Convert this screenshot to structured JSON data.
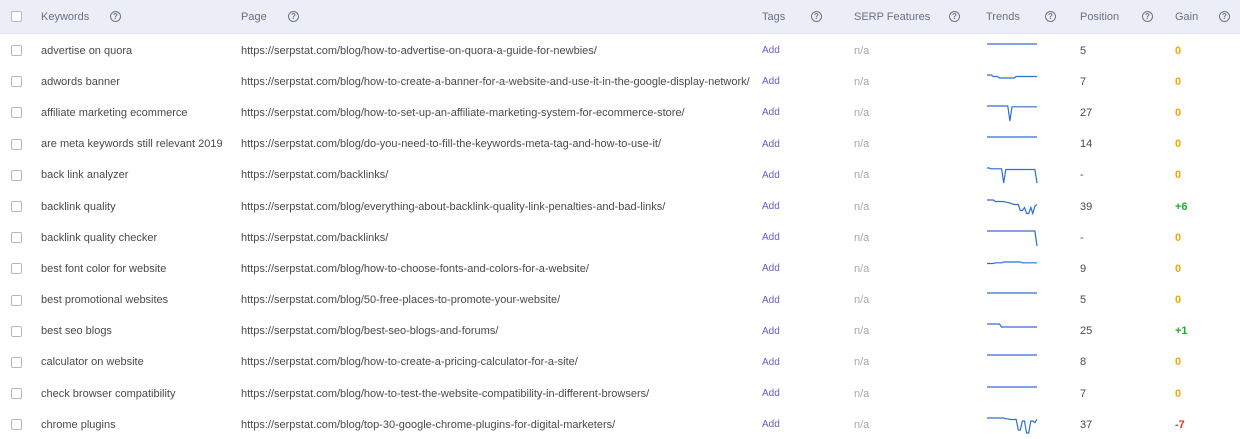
{
  "header": {
    "keywords": "Keywords",
    "page": "Page",
    "tags": "Tags",
    "serp": "SERP Features",
    "trends": "Trends",
    "position": "Position",
    "gain": "Gain",
    "help_glyph": "?"
  },
  "colors": {
    "header_bg": "#eceef7",
    "add_link": "#6a5acd",
    "gain_zero": "#f5a700",
    "gain_up": "#1fae2f",
    "gain_down": "#e4332a",
    "trend_line": "#2d6fd1"
  },
  "rows": [
    {
      "keyword": "advertise on quora",
      "url": "https://serpstat.com/blog/how-to-advertise-on-quora-a-guide-for-newbies/",
      "tags": "Add",
      "serp": "n/a",
      "position": "5",
      "gain": "0",
      "trend": [
        0,
        0,
        0,
        0,
        0,
        0,
        0,
        0,
        0,
        0,
        0,
        0,
        0,
        0,
        0,
        0,
        0,
        0,
        0,
        0,
        0,
        0,
        0,
        0,
        0
      ]
    },
    {
      "keyword": "adwords banner",
      "url": "https://serpstat.com/blog/how-to-create-a-banner-for-a-website-and-use-it-in-the-google-display-network/",
      "tags": "Add",
      "serp": "n/a",
      "position": "7",
      "gain": "0",
      "trend": [
        0,
        0,
        0,
        0.1,
        0.1,
        0.1,
        0.2,
        0.2,
        0.2,
        0.2,
        0.2,
        0.2,
        0.2,
        0.2,
        0.1,
        0.1,
        0.1,
        0.1,
        0.1,
        0.1,
        0.1,
        0.1,
        0.1,
        0.1,
        0.1
      ]
    },
    {
      "keyword": "affiliate marketing ecommerce",
      "url": "https://serpstat.com/blog/how-to-set-up-an-affiliate-marketing-system-for-ecommerce-store/",
      "tags": "Add",
      "serp": "n/a",
      "position": "27",
      "gain": "0",
      "trend": [
        0,
        0,
        0,
        0,
        0,
        0,
        0,
        0,
        0,
        0,
        0,
        1,
        0.05,
        0.05,
        0.05,
        0.05,
        0.05,
        0.05,
        0.05,
        0.05,
        0.05,
        0.05,
        0.05,
        0.05,
        0.05
      ]
    },
    {
      "keyword": "are meta keywords still relevant 2019",
      "url": "https://serpstat.com/blog/do-you-need-to-fill-the-keywords-meta-tag-and-how-to-use-it/",
      "tags": "Add",
      "serp": "n/a",
      "position": "14",
      "gain": "0",
      "trend": [
        0,
        0,
        0,
        0,
        0,
        0,
        0,
        0,
        0,
        0,
        0,
        0,
        0,
        0,
        0,
        0,
        0,
        0,
        0,
        0,
        0,
        0,
        0,
        0,
        0
      ]
    },
    {
      "keyword": "back link analyzer",
      "url": "https://serpstat.com/backlinks/",
      "tags": "Add",
      "serp": "n/a",
      "position": "-",
      "gain": "0",
      "trend": [
        0,
        0,
        0.05,
        0.05,
        0.05,
        0.05,
        0.05,
        0.05,
        1,
        0.1,
        0.1,
        0.1,
        0.1,
        0.1,
        0.1,
        0.1,
        0.1,
        0.1,
        0.1,
        0.1,
        0.1,
        0.1,
        0.1,
        0.1,
        1
      ]
    },
    {
      "keyword": "backlink quality",
      "url": "https://serpstat.com/blog/everything-about-backlink-quality-link-penalties-and-bad-links/",
      "tags": "Add",
      "serp": "n/a",
      "position": "39",
      "gain": "+6",
      "trend": [
        0,
        0,
        0,
        0,
        0.1,
        0.1,
        0.1,
        0.1,
        0.1,
        0.15,
        0.15,
        0.2,
        0.25,
        0.3,
        0.3,
        0.3,
        0.7,
        0.7,
        0.5,
        0.9,
        0.9,
        0.5,
        0.9,
        0.4,
        0.3
      ]
    },
    {
      "keyword": "backlink quality checker",
      "url": "https://serpstat.com/backlinks/",
      "tags": "Add",
      "serp": "n/a",
      "position": "-",
      "gain": "0",
      "trend": [
        0,
        0,
        0,
        0,
        0,
        0,
        0,
        0,
        0,
        0,
        0,
        0,
        0,
        0,
        0,
        0,
        0,
        0,
        0,
        0,
        0,
        0,
        0,
        0,
        1
      ]
    },
    {
      "keyword": "best font color for website",
      "url": "https://serpstat.com/blog/how-to-choose-fonts-and-colors-for-a-website/",
      "tags": "Add",
      "serp": "n/a",
      "position": "9",
      "gain": "0",
      "trend": [
        0.1,
        0.1,
        0.1,
        0.1,
        0.05,
        0.05,
        0.05,
        0.05,
        0,
        0,
        0,
        0,
        0,
        0,
        0,
        0,
        0,
        0.05,
        0.05,
        0.05,
        0.05,
        0.05,
        0.05,
        0.05,
        0.05
      ]
    },
    {
      "keyword": "best promotional websites",
      "url": "https://serpstat.com/blog/50-free-places-to-promote-your-website/",
      "tags": "Add",
      "serp": "n/a",
      "position": "5",
      "gain": "0",
      "trend": [
        0,
        0,
        0,
        0,
        0,
        0,
        0,
        0,
        0,
        0,
        0,
        0,
        0,
        0,
        0,
        0,
        0,
        0,
        0,
        0,
        0,
        0,
        0,
        0,
        0
      ]
    },
    {
      "keyword": "best seo blogs",
      "url": "https://serpstat.com/blog/best-seo-blogs-and-forums/",
      "tags": "Add",
      "serp": "n/a",
      "position": "25",
      "gain": "+1",
      "trend": [
        0,
        0,
        0,
        0,
        0,
        0,
        0,
        0.2,
        0.2,
        0.2,
        0.2,
        0.2,
        0.2,
        0.2,
        0.2,
        0.2,
        0.2,
        0.2,
        0.2,
        0.2,
        0.2,
        0.2,
        0.2,
        0.2,
        0.2
      ]
    },
    {
      "keyword": "calculator on website",
      "url": "https://serpstat.com/blog/how-to-create-a-pricing-calculator-for-a-site/",
      "tags": "Add",
      "serp": "n/a",
      "position": "8",
      "gain": "0",
      "trend": [
        0,
        0,
        0,
        0,
        0,
        0,
        0,
        0,
        0,
        0,
        0,
        0,
        0,
        0,
        0,
        0,
        0,
        0,
        0,
        0,
        0,
        0,
        0,
        0,
        0
      ]
    },
    {
      "keyword": "check browser compatibility",
      "url": "https://serpstat.com/blog/how-to-test-the-website-compatibility-in-different-browsers/",
      "tags": "Add",
      "serp": "n/a",
      "position": "7",
      "gain": "0",
      "trend": [
        0,
        0,
        0,
        0,
        0,
        0,
        0,
        0,
        0,
        0,
        0,
        0,
        0,
        0,
        0,
        0,
        0,
        0,
        0,
        0,
        0,
        0,
        0,
        0,
        0
      ]
    },
    {
      "keyword": "chrome plugins",
      "url": "https://serpstat.com/blog/top-30-google-chrome-plugins-for-digital-marketers/",
      "tags": "Add",
      "serp": "n/a",
      "position": "37",
      "gain": "-7",
      "trend": [
        0,
        0,
        0,
        0,
        0,
        0,
        0,
        0,
        0,
        0.05,
        0.05,
        0.1,
        0.1,
        0.1,
        0.1,
        0.8,
        0.8,
        0.2,
        0.2,
        1,
        1,
        0.2,
        0.2,
        0.3,
        0.1
      ]
    }
  ]
}
